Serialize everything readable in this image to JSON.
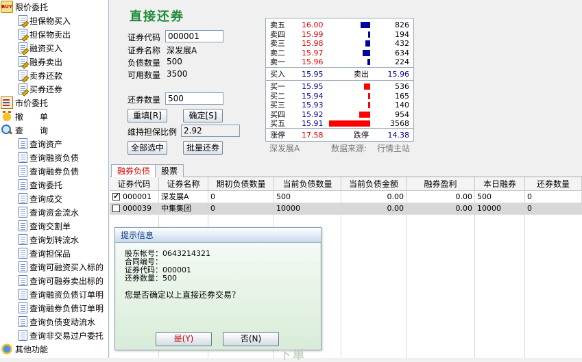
{
  "sidebar": {
    "items": [
      {
        "label": "限价委托",
        "icon": "buy-icon",
        "level": 0
      },
      {
        "label": "担保物买入",
        "icon": "edit-doc-icon",
        "level": 1
      },
      {
        "label": "担保物卖出",
        "icon": "edit-doc-icon",
        "level": 1
      },
      {
        "label": "融资买入",
        "icon": "edit-doc-icon",
        "level": 1
      },
      {
        "label": "融券卖出",
        "icon": "edit-doc-icon",
        "level": 1
      },
      {
        "label": "卖券还款",
        "icon": "edit-doc-icon",
        "level": 1
      },
      {
        "label": "买券还券",
        "icon": "edit-doc-icon",
        "level": 1
      },
      {
        "label": "市价委托",
        "icon": "market-order-icon",
        "level": 0
      },
      {
        "label": "撤　　单",
        "icon": "cancel-hand-icon",
        "level": 0
      },
      {
        "label": "查　　询",
        "icon": "search-icon",
        "level": 0
      },
      {
        "label": "查询资产",
        "icon": "doc-icon",
        "level": 1
      },
      {
        "label": "查询融资负债",
        "icon": "doc-icon",
        "level": 1
      },
      {
        "label": "查询融券负债",
        "icon": "doc-icon",
        "level": 1
      },
      {
        "label": "查询委托",
        "icon": "doc-icon",
        "level": 1
      },
      {
        "label": "查询成交",
        "icon": "doc-icon",
        "level": 1
      },
      {
        "label": "查询资金流水",
        "icon": "doc-icon",
        "level": 1
      },
      {
        "label": "查询交割单",
        "icon": "doc-icon",
        "level": 1
      },
      {
        "label": "查询划转流水",
        "icon": "doc-icon",
        "level": 1
      },
      {
        "label": "查询担保品",
        "icon": "doc-icon",
        "level": 1
      },
      {
        "label": "查询可融资买入标的",
        "icon": "doc-icon",
        "level": 1
      },
      {
        "label": "查询可融券卖出标的",
        "icon": "doc-icon",
        "level": 1
      },
      {
        "label": "查询融资负债订单明",
        "icon": "doc-icon",
        "level": 1
      },
      {
        "label": "查询融券负债订单明",
        "icon": "doc-icon",
        "level": 1
      },
      {
        "label": "查询负债变动流水",
        "icon": "doc-icon",
        "level": 1
      },
      {
        "label": "查询非交易过户委托",
        "icon": "doc-icon",
        "level": 1
      },
      {
        "label": "其他功能",
        "icon": "other-icon",
        "level": 0
      }
    ]
  },
  "form": {
    "title": "直接还券",
    "code_label": "证券代码",
    "code_value": "000001",
    "name_label": "证券名称",
    "name_value": "深发展A",
    "debt_label": "负债数量",
    "debt_value": "500",
    "avail_label": "可用数量",
    "avail_value": "3500",
    "repay_label": "还券数量",
    "repay_value": "500",
    "refill_button": "重填[R]",
    "confirm_button": "确定[S]",
    "ratio_label": "维持担保比例",
    "ratio_value": "2.92",
    "select_all_button": "全部选中",
    "batch_button": "批量还券"
  },
  "quote": {
    "sells": [
      {
        "name": "卖五",
        "price": "16.00",
        "volume": "826",
        "bar_fraction": 0.23
      },
      {
        "name": "卖四",
        "price": "15.99",
        "volume": "194",
        "bar_fraction": 0.05
      },
      {
        "name": "卖三",
        "price": "15.98",
        "volume": "432",
        "bar_fraction": 0.12
      },
      {
        "name": "卖二",
        "price": "15.97",
        "volume": "634",
        "bar_fraction": 0.18
      },
      {
        "name": "卖一",
        "price": "15.96",
        "volume": "224",
        "bar_fraction": 0.06
      }
    ],
    "bid_label": "买入",
    "bid_price": "15.95",
    "ask_label": "卖出",
    "ask_price": "15.96",
    "buys": [
      {
        "name": "买一",
        "price": "15.95",
        "volume": "536",
        "bar_fraction": 0.15
      },
      {
        "name": "买二",
        "price": "15.94",
        "volume": "165",
        "bar_fraction": 0.05
      },
      {
        "name": "买三",
        "price": "15.93",
        "volume": "140",
        "bar_fraction": 0.04
      },
      {
        "name": "买四",
        "price": "15.92",
        "volume": "954",
        "bar_fraction": 0.27
      },
      {
        "name": "买五",
        "price": "15.91",
        "volume": "3568",
        "bar_fraction": 1.0
      }
    ],
    "limit_up_label": "涨停",
    "limit_up": "17.58",
    "limit_down_label": "跌停",
    "limit_down": "14.38",
    "stock_name": "深发展A",
    "source_label": "数据来源:",
    "source_value": "行情主站",
    "sell_color": "#0000a0",
    "buy_color": "#ff0000"
  },
  "tabs": [
    {
      "label": "融券负债",
      "active": true
    },
    {
      "label": "股票",
      "active": false
    }
  ],
  "table": {
    "headers": [
      "证券代码",
      "证券名称",
      "期初负债数量",
      "当前负债数量",
      "当前负债金额",
      "融券盈利",
      "本日融券",
      "还券数量"
    ],
    "rows": [
      {
        "checked": true,
        "cells": [
          "000001",
          "深发展A",
          "0",
          "500",
          "0.00",
          "0.00",
          "500",
          "0"
        ]
      },
      {
        "checked": false,
        "cells": [
          "000039",
          "中集集团",
          "0",
          "10000",
          "0.00",
          "0.00",
          "10000",
          "0"
        ]
      }
    ]
  },
  "dialog": {
    "title": "提示信息",
    "lines": [
      "股东帐号：0643214321",
      "合同编号：",
      "证券代码：000001",
      "还券数量：500"
    ],
    "question": "您是否确定以上直接还券交易？",
    "yes_button": "是(Y)",
    "no_button": "否(N)",
    "watermark": "下单"
  }
}
